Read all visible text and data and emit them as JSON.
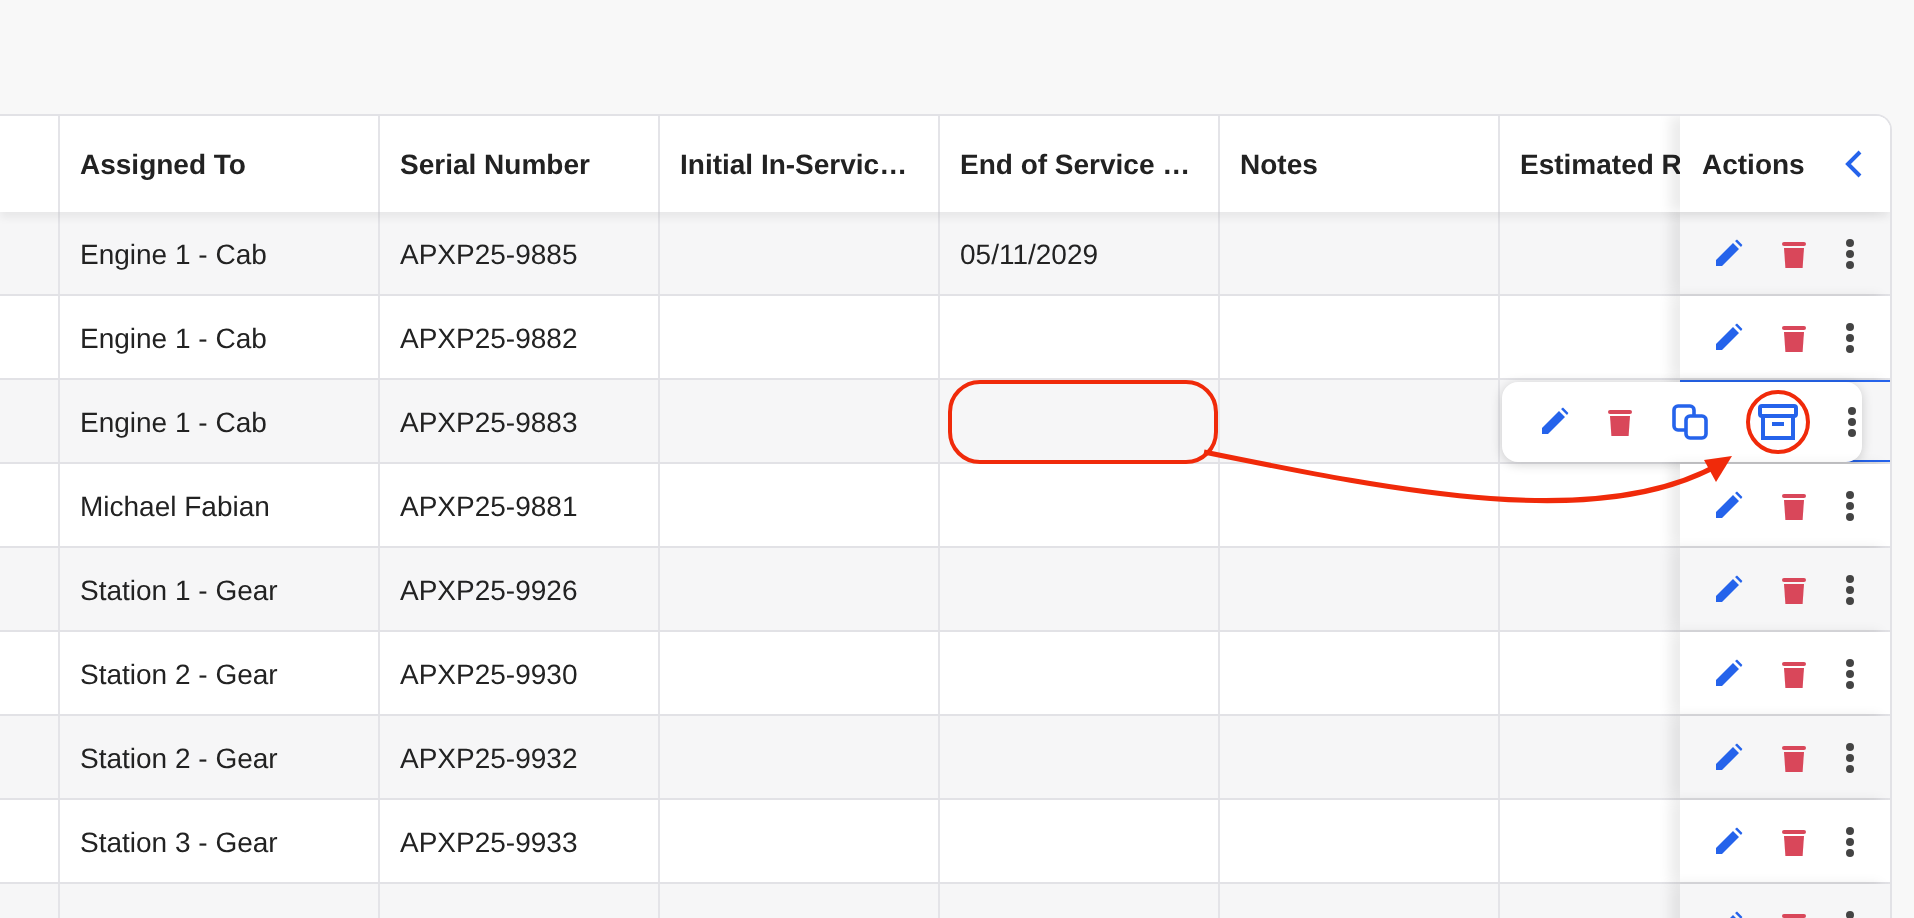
{
  "table": {
    "columns": [
      "Assigned To",
      "Serial Number",
      "Initial In-Servic…",
      "End of Service …",
      "Notes",
      "Estimated R"
    ],
    "actions_header": "Actions",
    "rows": [
      {
        "assigned_to": "Engine 1 - Cab",
        "serial": "APXP25-9885",
        "end_of_service": "05/11/2029",
        "hovered": false
      },
      {
        "assigned_to": "Engine 1 - Cab",
        "serial": "APXP25-9882",
        "hovered": false
      },
      {
        "assigned_to": "Engine 1 - Cab",
        "serial": "APXP25-9883",
        "hovered": true
      },
      {
        "assigned_to": "Michael Fabian",
        "serial": "APXP25-9881",
        "hovered": false
      },
      {
        "assigned_to": "Station 1 - Gear",
        "serial": "APXP25-9926",
        "hovered": false
      },
      {
        "assigned_to": "Station 2 - Gear",
        "serial": "APXP25-9930",
        "hovered": false
      },
      {
        "assigned_to": "Station 2 - Gear",
        "serial": "APXP25-9932",
        "hovered": false
      },
      {
        "assigned_to": "Station 3 - Gear",
        "serial": "APXP25-9933",
        "hovered": false
      },
      {
        "hovered": false
      }
    ]
  },
  "annotations": [
    {
      "kind": "box"
    },
    {
      "kind": "arrow"
    },
    {
      "kind": "circle"
    }
  ]
}
